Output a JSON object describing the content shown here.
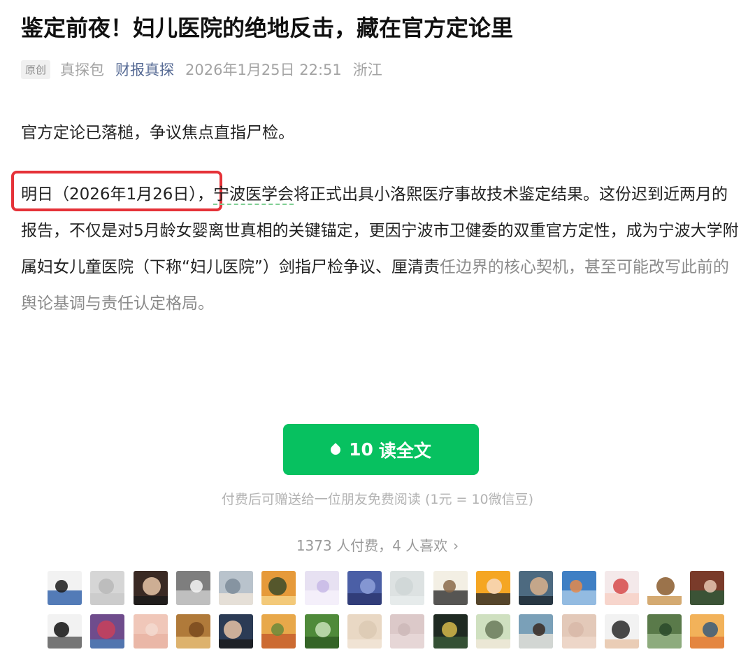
{
  "article": {
    "title": "鉴定前夜！妇儿医院的绝地反击，藏在官方定论里",
    "meta": {
      "tag": "原创",
      "author": "真探包",
      "account": "财报真探",
      "datetime": "2026年1月25日 22:51",
      "location": "浙江"
    },
    "lead": "官方定论已落槌，争议焦点直指尸检。",
    "body": {
      "highlight": "明日（2026年1月26日）",
      "sep": "，",
      "org": "宁波医学会",
      "rest": "将正式出具小洛熙医疗事故技术鉴定结果。这份迟到近两月的报告，不仅是对5月龄女婴离世真相的关键锚定，更因宁波市卫健委的双重官方定性，成为宁波大学附属妇女儿童医院（下称“妇儿医院”）剑指尸检争议、厘清责",
      "faded": "任边界的核心契机，甚至可能改写此前的舆论基调与责任认定格局。"
    }
  },
  "paywall": {
    "button_amount": "10",
    "button_label": "读全文",
    "gift_note": "付费后可赠送给一位朋友免费阅读 (1元 = 10微信豆)",
    "counts": "1373 人付费，4 人喜欢"
  },
  "colors": {
    "accent_green": "#07c160",
    "link_blue": "#576b95",
    "highlight_red": "#e53238"
  },
  "avatars": [
    {
      "name": "avatar-1",
      "colors": [
        "#f2f2f2",
        "#1b1b1b",
        "#2a5ca8"
      ]
    },
    {
      "name": "avatar-2",
      "colors": [
        "#d6d6d6",
        "#b8b8b8",
        "#c9c9c9"
      ]
    },
    {
      "name": "avatar-3",
      "colors": [
        "#3a2a24",
        "#e8c6a8",
        "#1a1a1a"
      ]
    },
    {
      "name": "avatar-4",
      "colors": [
        "#7e7e7e",
        "#f4f4f4",
        "#cfcfcf"
      ]
    },
    {
      "name": "avatar-5",
      "colors": [
        "#b9c3cc",
        "#7d8c99",
        "#f0e6da"
      ]
    },
    {
      "name": "avatar-6",
      "colors": [
        "#e69a3a",
        "#3b4b2a",
        "#f6d58a"
      ]
    },
    {
      "name": "avatar-7",
      "colors": [
        "#e7e1f2",
        "#c7b8e6",
        "#f7f3fb"
      ]
    },
    {
      "name": "avatar-8",
      "colors": [
        "#4b5fa6",
        "#8ea0d9",
        "#2b356e"
      ]
    },
    {
      "name": "avatar-9",
      "colors": [
        "#dde2e2",
        "#cfd6d6",
        "#e9eded"
      ]
    },
    {
      "name": "avatar-10",
      "colors": [
        "#f3efe4",
        "#8a6a4a",
        "#2e2e2e"
      ]
    },
    {
      "name": "avatar-11",
      "colors": [
        "#f5a623",
        "#f7d9c0",
        "#2d2d2d"
      ]
    },
    {
      "name": "avatar-12",
      "colors": [
        "#4d6a80",
        "#d9b08c",
        "#1f2a33"
      ]
    },
    {
      "name": "avatar-13",
      "colors": [
        "#3f7fc4",
        "#e58a4b",
        "#a9cbe8"
      ]
    },
    {
      "name": "avatar-14",
      "colors": [
        "#f4e9ea",
        "#d64a4a",
        "#f7d0c4"
      ]
    },
    {
      "name": "avatar-15",
      "colors": [
        "#ffffff",
        "#8a5a2b",
        "#c9954f"
      ]
    },
    {
      "name": "avatar-16",
      "colors": [
        "#7a3b2a",
        "#e6c6b0",
        "#2c5a3a"
      ]
    },
    {
      "name": "avatar-17",
      "colors": [
        "#f2f2f2",
        "#111111",
        "#555555"
      ]
    },
    {
      "name": "avatar-18",
      "colors": [
        "#6f4c8c",
        "#c9415a",
        "#4a7fb8"
      ]
    },
    {
      "name": "avatar-19",
      "colors": [
        "#f0c7b9",
        "#f3d9cf",
        "#e9b3a3"
      ]
    },
    {
      "name": "avatar-20",
      "colors": [
        "#b07a3a",
        "#7a4a1e",
        "#e8c07a"
      ]
    },
    {
      "name": "avatar-21",
      "colors": [
        "#2b3b55",
        "#e7c3a6",
        "#1a1a1a"
      ]
    },
    {
      "name": "avatar-22",
      "colors": [
        "#e8a84a",
        "#6b8a3a",
        "#c45a2a"
      ]
    },
    {
      "name": "avatar-23",
      "colors": [
        "#4f8a3a",
        "#c7e0b8",
        "#2d5a22"
      ]
    },
    {
      "name": "avatar-24",
      "colors": [
        "#e9d8c4",
        "#dccab4",
        "#f1e6d8"
      ]
    },
    {
      "name": "avatar-25",
      "colors": [
        "#dcc9c9",
        "#cdb9b9",
        "#e8dada"
      ]
    },
    {
      "name": "avatar-26",
      "colors": [
        "#1f2a22",
        "#d6b84a",
        "#3a5a3a"
      ]
    },
    {
      "name": "avatar-27",
      "colors": [
        "#cfe0c0",
        "#6a7a5a",
        "#f1e9d9"
      ]
    },
    {
      "name": "avatar-28",
      "colors": [
        "#7aa0b8",
        "#3a2a22",
        "#e9e3d9"
      ]
    },
    {
      "name": "avatar-29",
      "colors": [
        "#e3c9b9",
        "#d8b8a8",
        "#efd9cc"
      ]
    },
    {
      "name": "avatar-30",
      "colors": [
        "#f2f2f2",
        "#2a2a2a",
        "#e7c3a6"
      ]
    },
    {
      "name": "avatar-31",
      "colors": [
        "#5a7a4a",
        "#2a4a2a",
        "#9ab88a"
      ]
    },
    {
      "name": "avatar-32",
      "colors": [
        "#f2b25a",
        "#3a5a7a",
        "#e07a3a"
      ]
    }
  ]
}
